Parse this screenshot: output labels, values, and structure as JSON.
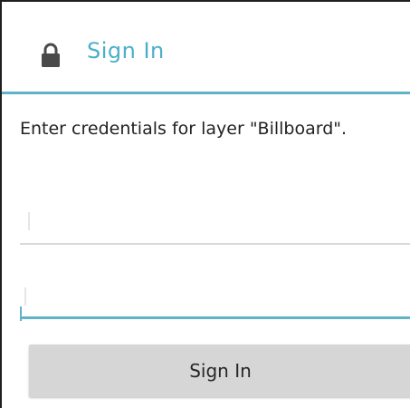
{
  "dialog": {
    "title": "Sign In",
    "message": "Enter credentials for layer \"Billboard\".",
    "lock_icon": "lock-icon",
    "accent_color": "#4ab0c9",
    "username": {
      "value": "",
      "placeholder": ""
    },
    "password": {
      "value": "",
      "placeholder": ""
    },
    "signin_label": "Sign In"
  }
}
